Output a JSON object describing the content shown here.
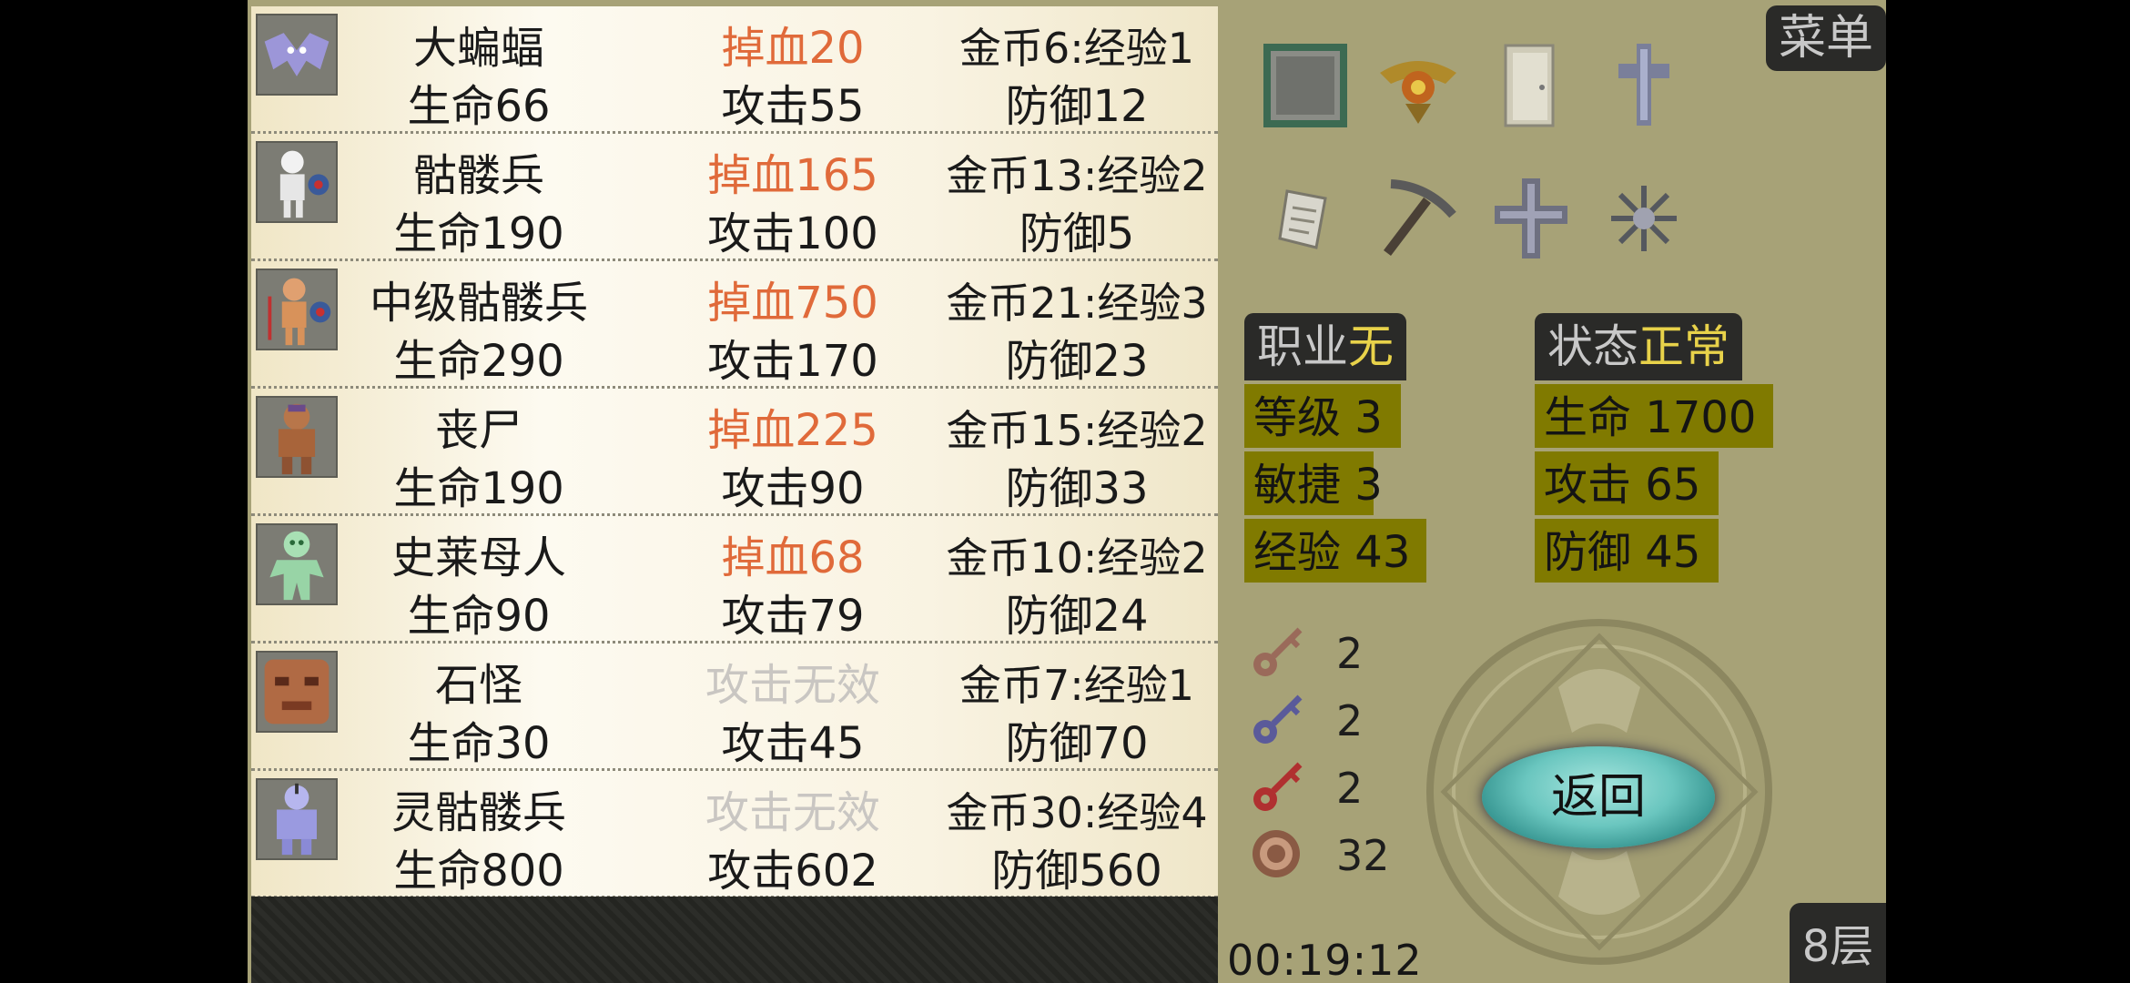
{
  "menu_label": "菜单",
  "floor_label": "8层",
  "timer": "00:19:12",
  "back_label": "返回",
  "monsters": [
    {
      "name": "大蝙蝠",
      "damage": "掉血20",
      "reward": "金币6:经验1",
      "hp": "生命66",
      "atk": "攻击55",
      "def": "防御12",
      "icon": "bat-icon"
    },
    {
      "name": "骷髅兵",
      "damage": "掉血165",
      "reward": "金币13:经验2",
      "hp": "生命190",
      "atk": "攻击100",
      "def": "防御5",
      "icon": "skeleton-icon"
    },
    {
      "name": "中级骷髅兵",
      "damage": "掉血750",
      "reward": "金币21:经验3",
      "hp": "生命290",
      "atk": "攻击170",
      "def": "防御23",
      "icon": "skeleton-captain-icon"
    },
    {
      "name": "丧尸",
      "damage": "掉血225",
      "reward": "金币15:经验2",
      "hp": "生命190",
      "atk": "攻击90",
      "def": "防御33",
      "icon": "zombie-icon"
    },
    {
      "name": "史莱母人",
      "damage": "掉血68",
      "reward": "金币10:经验2",
      "hp": "生命90",
      "atk": "攻击79",
      "def": "防御24",
      "icon": "slime-man-icon"
    },
    {
      "name": "石怪",
      "damage": "攻击无效",
      "reward": "金币7:经验1",
      "hp": "生命30",
      "atk": "攻击45",
      "def": "防御70",
      "icon": "stone-golem-icon"
    },
    {
      "name": "灵骷髅兵",
      "damage": "攻击无效",
      "reward": "金币30:经验4",
      "hp": "生命800",
      "atk": "攻击602",
      "def": "防御560",
      "icon": "ghost-skeleton-icon"
    }
  ],
  "items": [
    {
      "icon": "mirror-icon"
    },
    {
      "icon": "winged-emblem-icon"
    },
    {
      "icon": "door-icon"
    },
    {
      "icon": "cross-sword-icon"
    },
    {
      "icon": "scroll-icon"
    },
    {
      "icon": "pickaxe-icon"
    },
    {
      "icon": "holy-cross-icon"
    },
    {
      "icon": "snowflake-icon"
    }
  ],
  "job": {
    "label": "职业",
    "value": "无"
  },
  "status": {
    "label": "状态",
    "value": "正常"
  },
  "stats_left": [
    {
      "label": "等级",
      "value": "3"
    },
    {
      "label": "敏捷",
      "value": "3"
    },
    {
      "label": "经验",
      "value": "43"
    }
  ],
  "stats_right": [
    {
      "label": "生命",
      "value": "1700"
    },
    {
      "label": "攻击",
      "value": "65"
    },
    {
      "label": "防御",
      "value": "45"
    }
  ],
  "keys": [
    {
      "icon": "yellow-key-icon",
      "count": "2",
      "color": "#9a6a5a"
    },
    {
      "icon": "blue-key-icon",
      "count": "2",
      "color": "#5a5a9a"
    },
    {
      "icon": "red-key-icon",
      "count": "2",
      "color": "#b03030"
    }
  ],
  "coins": {
    "icon": "coin-icon",
    "count": "32"
  },
  "colors": {
    "damage": "#e06a3a",
    "damage_invalid": "#c9c6c2",
    "stat_bg": "#807a00",
    "status_value": "#e8d24a",
    "panel_bg": "#a7a277"
  }
}
